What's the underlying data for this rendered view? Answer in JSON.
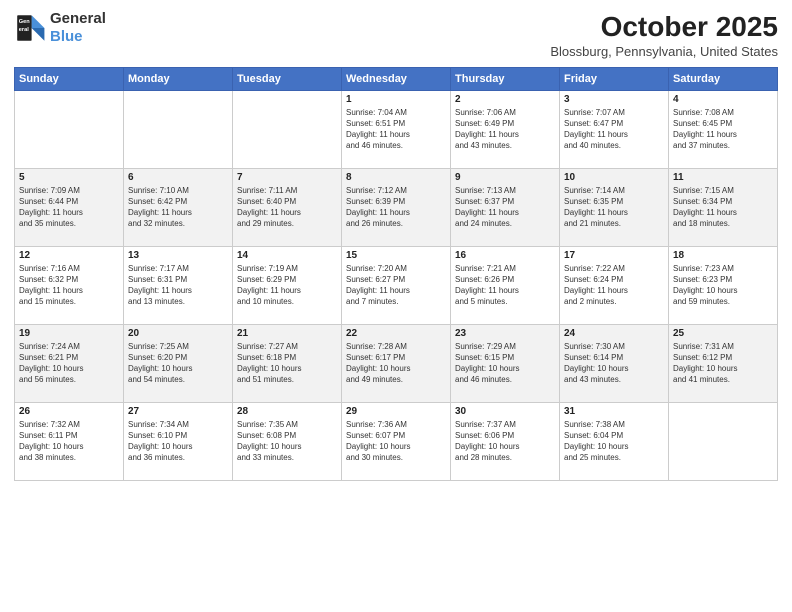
{
  "header": {
    "logo_line1": "General",
    "logo_line2": "Blue",
    "month_title": "October 2025",
    "subtitle": "Blossburg, Pennsylvania, United States"
  },
  "days_of_week": [
    "Sunday",
    "Monday",
    "Tuesday",
    "Wednesday",
    "Thursday",
    "Friday",
    "Saturday"
  ],
  "weeks": [
    [
      {
        "num": "",
        "info": ""
      },
      {
        "num": "",
        "info": ""
      },
      {
        "num": "",
        "info": ""
      },
      {
        "num": "1",
        "info": "Sunrise: 7:04 AM\nSunset: 6:51 PM\nDaylight: 11 hours\nand 46 minutes."
      },
      {
        "num": "2",
        "info": "Sunrise: 7:06 AM\nSunset: 6:49 PM\nDaylight: 11 hours\nand 43 minutes."
      },
      {
        "num": "3",
        "info": "Sunrise: 7:07 AM\nSunset: 6:47 PM\nDaylight: 11 hours\nand 40 minutes."
      },
      {
        "num": "4",
        "info": "Sunrise: 7:08 AM\nSunset: 6:45 PM\nDaylight: 11 hours\nand 37 minutes."
      }
    ],
    [
      {
        "num": "5",
        "info": "Sunrise: 7:09 AM\nSunset: 6:44 PM\nDaylight: 11 hours\nand 35 minutes."
      },
      {
        "num": "6",
        "info": "Sunrise: 7:10 AM\nSunset: 6:42 PM\nDaylight: 11 hours\nand 32 minutes."
      },
      {
        "num": "7",
        "info": "Sunrise: 7:11 AM\nSunset: 6:40 PM\nDaylight: 11 hours\nand 29 minutes."
      },
      {
        "num": "8",
        "info": "Sunrise: 7:12 AM\nSunset: 6:39 PM\nDaylight: 11 hours\nand 26 minutes."
      },
      {
        "num": "9",
        "info": "Sunrise: 7:13 AM\nSunset: 6:37 PM\nDaylight: 11 hours\nand 24 minutes."
      },
      {
        "num": "10",
        "info": "Sunrise: 7:14 AM\nSunset: 6:35 PM\nDaylight: 11 hours\nand 21 minutes."
      },
      {
        "num": "11",
        "info": "Sunrise: 7:15 AM\nSunset: 6:34 PM\nDaylight: 11 hours\nand 18 minutes."
      }
    ],
    [
      {
        "num": "12",
        "info": "Sunrise: 7:16 AM\nSunset: 6:32 PM\nDaylight: 11 hours\nand 15 minutes."
      },
      {
        "num": "13",
        "info": "Sunrise: 7:17 AM\nSunset: 6:31 PM\nDaylight: 11 hours\nand 13 minutes."
      },
      {
        "num": "14",
        "info": "Sunrise: 7:19 AM\nSunset: 6:29 PM\nDaylight: 11 hours\nand 10 minutes."
      },
      {
        "num": "15",
        "info": "Sunrise: 7:20 AM\nSunset: 6:27 PM\nDaylight: 11 hours\nand 7 minutes."
      },
      {
        "num": "16",
        "info": "Sunrise: 7:21 AM\nSunset: 6:26 PM\nDaylight: 11 hours\nand 5 minutes."
      },
      {
        "num": "17",
        "info": "Sunrise: 7:22 AM\nSunset: 6:24 PM\nDaylight: 11 hours\nand 2 minutes."
      },
      {
        "num": "18",
        "info": "Sunrise: 7:23 AM\nSunset: 6:23 PM\nDaylight: 10 hours\nand 59 minutes."
      }
    ],
    [
      {
        "num": "19",
        "info": "Sunrise: 7:24 AM\nSunset: 6:21 PM\nDaylight: 10 hours\nand 56 minutes."
      },
      {
        "num": "20",
        "info": "Sunrise: 7:25 AM\nSunset: 6:20 PM\nDaylight: 10 hours\nand 54 minutes."
      },
      {
        "num": "21",
        "info": "Sunrise: 7:27 AM\nSunset: 6:18 PM\nDaylight: 10 hours\nand 51 minutes."
      },
      {
        "num": "22",
        "info": "Sunrise: 7:28 AM\nSunset: 6:17 PM\nDaylight: 10 hours\nand 49 minutes."
      },
      {
        "num": "23",
        "info": "Sunrise: 7:29 AM\nSunset: 6:15 PM\nDaylight: 10 hours\nand 46 minutes."
      },
      {
        "num": "24",
        "info": "Sunrise: 7:30 AM\nSunset: 6:14 PM\nDaylight: 10 hours\nand 43 minutes."
      },
      {
        "num": "25",
        "info": "Sunrise: 7:31 AM\nSunset: 6:12 PM\nDaylight: 10 hours\nand 41 minutes."
      }
    ],
    [
      {
        "num": "26",
        "info": "Sunrise: 7:32 AM\nSunset: 6:11 PM\nDaylight: 10 hours\nand 38 minutes."
      },
      {
        "num": "27",
        "info": "Sunrise: 7:34 AM\nSunset: 6:10 PM\nDaylight: 10 hours\nand 36 minutes."
      },
      {
        "num": "28",
        "info": "Sunrise: 7:35 AM\nSunset: 6:08 PM\nDaylight: 10 hours\nand 33 minutes."
      },
      {
        "num": "29",
        "info": "Sunrise: 7:36 AM\nSunset: 6:07 PM\nDaylight: 10 hours\nand 30 minutes."
      },
      {
        "num": "30",
        "info": "Sunrise: 7:37 AM\nSunset: 6:06 PM\nDaylight: 10 hours\nand 28 minutes."
      },
      {
        "num": "31",
        "info": "Sunrise: 7:38 AM\nSunset: 6:04 PM\nDaylight: 10 hours\nand 25 minutes."
      },
      {
        "num": "",
        "info": ""
      }
    ]
  ]
}
